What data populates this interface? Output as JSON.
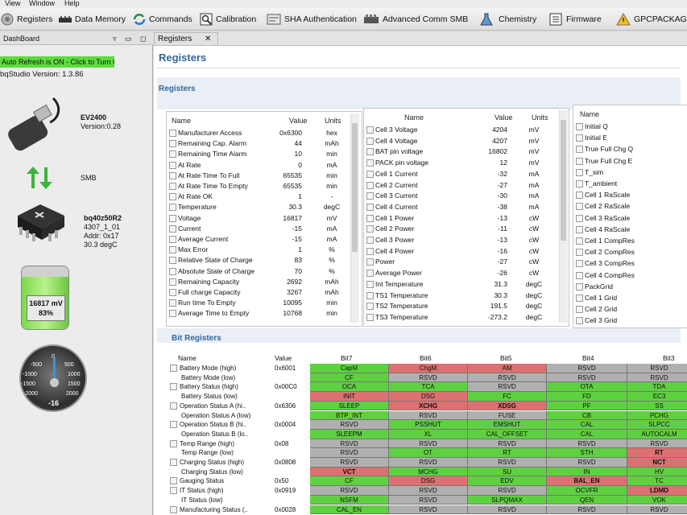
{
  "menu": [
    "View",
    "Window",
    "Help"
  ],
  "toolbar": [
    "Registers",
    "Data Memory",
    "Commands",
    "Calibration",
    "SHA Authentication",
    "Advanced Comm SMB",
    "Chemistry",
    "Firmware",
    "GPCPACKAGE"
  ],
  "dashboard": {
    "tab": "DashBoard",
    "auto_refresh": "Auto Refresh is ON - Click to Turn OFF",
    "version": "bqStudio Version:  1.3.86",
    "ev_name": "EV2400",
    "ev_version": "Version:0.28",
    "bus": "SMB",
    "device": "bq40z50R2",
    "device_fw": "4307_1_01",
    "device_addr": "Addr: 0x17",
    "device_temp": "30.3 degC",
    "battery_voltage": "16817 mV",
    "battery_soc": "83%",
    "battery_level": 0.83,
    "gauge_ticks": [
      "-500",
      "0",
      "500",
      "-1000",
      "1000",
      "-1500",
      "1500",
      "-2000",
      "2000"
    ],
    "gauge_value": "-16"
  },
  "main": {
    "tab": "Registers",
    "title": "Registers",
    "section": "Registers",
    "bit_section": "Bit Registers"
  },
  "panel1": {
    "headers": [
      "Name",
      "Value",
      "Units"
    ],
    "rows": [
      [
        "Manufacturer Access",
        "0x6300",
        "hex"
      ],
      [
        "Remaining Cap. Alarm",
        "44",
        "mAh"
      ],
      [
        "Remaining Time Alarm",
        "10",
        "min"
      ],
      [
        "At Rate",
        "0",
        "mA"
      ],
      [
        "At Rate Time To Full",
        "65535",
        "min"
      ],
      [
        "At Rate Time To Empty",
        "65535",
        "min"
      ],
      [
        "At Rate OK",
        "1",
        "-"
      ],
      [
        "Temperature",
        "30.3",
        "degC"
      ],
      [
        "Voltage",
        "16817",
        "mV"
      ],
      [
        "Current",
        "-15",
        "mA"
      ],
      [
        "Average Current",
        "-15",
        "mA"
      ],
      [
        "Max Error",
        "1",
        "%"
      ],
      [
        "Relative State of Charge",
        "83",
        "%"
      ],
      [
        "Absolute State of Charge",
        "70",
        "%"
      ],
      [
        "Remaining Capacity",
        "2692",
        "mAh"
      ],
      [
        "Full charge Capacity",
        "3267",
        "mAh"
      ],
      [
        "Run time To Empty",
        "10095",
        "min"
      ],
      [
        "Average Time to Empty",
        "10768",
        "min"
      ]
    ]
  },
  "panel2": {
    "headers": [
      "Name",
      "Value",
      "Units"
    ],
    "rows": [
      [
        "Cell 3 Voltage",
        "4204",
        "mV"
      ],
      [
        "Cell 4 Voltage",
        "4207",
        "mV"
      ],
      [
        "BAT pin voltage",
        "16802",
        "mV"
      ],
      [
        "PACK pin voltage",
        "12",
        "mV"
      ],
      [
        "Cell 1 Current",
        "-32",
        "mA"
      ],
      [
        "Cell 2 Current",
        "-27",
        "mA"
      ],
      [
        "Cell 3 Current",
        "-30",
        "mA"
      ],
      [
        "Cell 4 Current",
        "-38",
        "mA"
      ],
      [
        "Cell 1 Power",
        "-13",
        "cW"
      ],
      [
        "Cell 2 Power",
        "-11",
        "cW"
      ],
      [
        "Cell 3 Power",
        "-13",
        "cW"
      ],
      [
        "Cell 4 Power",
        "-16",
        "cW"
      ],
      [
        "Power",
        "-27",
        "cW"
      ],
      [
        "Average Power",
        "-26",
        "cW"
      ],
      [
        "Int Temperature",
        "31.3",
        "degC"
      ],
      [
        "TS1 Temperature",
        "30.3",
        "degC"
      ],
      [
        "TS2 Temperature",
        "191.5",
        "degC"
      ],
      [
        "TS3 Temperature",
        "-273.2",
        "degC"
      ]
    ]
  },
  "panel3": {
    "headers": [
      "Name"
    ],
    "rows": [
      "Initial Q",
      "Initial E",
      "True Full Chg Q",
      "True Full Chg E",
      "T_sim",
      "T_ambient",
      "Cell 1 RaScale",
      "Cell 2 RaScale",
      "Cell 3 RaScale",
      "Cell 4 RaScale",
      "Cell 1 CompRes",
      "Cell 2 CompRes",
      "Cell 3 CompRes",
      "Cell 4 CompRes",
      "PackGrid",
      "Cell 1 Grid",
      "Cell 2 Grid",
      "Cell 3 Grid"
    ]
  },
  "bits": {
    "headers": [
      "Name",
      "Value",
      "Bit7",
      "Bit6",
      "Bit5",
      "Bit4",
      "Bit3"
    ],
    "rows": [
      {
        "name": "Battery Mode (high)",
        "value": "0x6001",
        "cb": true,
        "cells": [
          [
            "CapM",
            "g"
          ],
          [
            "ChgM",
            "r"
          ],
          [
            "AM",
            "r"
          ],
          [
            "RSVD",
            "y"
          ],
          [
            "RSVD",
            "y"
          ]
        ]
      },
      {
        "name": "Battery Mode (low)",
        "value": "",
        "cb": false,
        "cells": [
          [
            "CF",
            "g"
          ],
          [
            "RSVD",
            "y"
          ],
          [
            "RSVD",
            "y"
          ],
          [
            "RSVD",
            "y"
          ],
          [
            "RSVD",
            "y"
          ]
        ]
      },
      {
        "name": "Battery Status (high)",
        "value": "0x00C0",
        "cb": true,
        "cells": [
          [
            "OCA",
            "g"
          ],
          [
            "TCA",
            "g"
          ],
          [
            "RSVD",
            "y"
          ],
          [
            "OTA",
            "g"
          ],
          [
            "TDA",
            "g"
          ]
        ]
      },
      {
        "name": "Battery Status (low)",
        "value": "",
        "cb": false,
        "cells": [
          [
            "INIT",
            "r"
          ],
          [
            "DSG",
            "r"
          ],
          [
            "FC",
            "g"
          ],
          [
            "FD",
            "g"
          ],
          [
            "EC3",
            "g"
          ]
        ]
      },
      {
        "name": "Operation Status A (hi..",
        "value": "0x6306",
        "cb": true,
        "cells": [
          [
            "SLEEP",
            "g"
          ],
          [
            "XCHG",
            "r"
          ],
          [
            "XDSG",
            "r"
          ],
          [
            "PF",
            "g"
          ],
          [
            "SS",
            "g"
          ]
        ]
      },
      {
        "name": "Operation Status A (low)",
        "value": "",
        "cb": false,
        "cells": [
          [
            "BTP_INT",
            "g"
          ],
          [
            "RSVD",
            "y"
          ],
          [
            "FUSE",
            "y"
          ],
          [
            "CB",
            "g"
          ],
          [
            "PCHG",
            "g"
          ]
        ]
      },
      {
        "name": "Operation Status B (hi..",
        "value": "0x0004",
        "cb": true,
        "cells": [
          [
            "RSVD",
            "y"
          ],
          [
            "PSSHUT",
            "g"
          ],
          [
            "EMSHUT",
            "g"
          ],
          [
            "CAL",
            "g"
          ],
          [
            "SLPCC",
            "g"
          ]
        ]
      },
      {
        "name": "Operation Status B (lo..",
        "value": "",
        "cb": false,
        "cells": [
          [
            "SLEEPM",
            "g"
          ],
          [
            "XL",
            "g"
          ],
          [
            "CAL_OFFSET",
            "g"
          ],
          [
            "CAL",
            "g"
          ],
          [
            "AUTOCALM",
            "g"
          ]
        ]
      },
      {
        "name": "Temp Range (high)",
        "value": "0x08",
        "cb": true,
        "cells": [
          [
            "RSVD",
            "y"
          ],
          [
            "RSVD",
            "y"
          ],
          [
            "RSVD",
            "y"
          ],
          [
            "RSVD",
            "y"
          ],
          [
            "RSVD",
            "y"
          ]
        ]
      },
      {
        "name": "Temp Range (low)",
        "value": "",
        "cb": false,
        "cells": [
          [
            "RSVD",
            "y"
          ],
          [
            "OT",
            "g"
          ],
          [
            "RT",
            "g"
          ],
          [
            "STH",
            "g"
          ],
          [
            "RT",
            "r"
          ]
        ]
      },
      {
        "name": "Charging Status (high)",
        "value": "0x0808",
        "cb": true,
        "cells": [
          [
            "RSVD",
            "y"
          ],
          [
            "RSVD",
            "y"
          ],
          [
            "RSVD",
            "y"
          ],
          [
            "RSVD",
            "y"
          ],
          [
            "NCT",
            "r"
          ]
        ]
      },
      {
        "name": "Charging Status (low)",
        "value": "",
        "cb": false,
        "cells": [
          [
            "VCT",
            "r"
          ],
          [
            "MCHG",
            "g"
          ],
          [
            "SU",
            "g"
          ],
          [
            "IN",
            "g"
          ],
          [
            "HV",
            "g"
          ]
        ]
      },
      {
        "name": "Gauging Status",
        "value": "0x50",
        "cb": true,
        "cells": [
          [
            "CF",
            "g"
          ],
          [
            "DSG",
            "r"
          ],
          [
            "EDV",
            "g"
          ],
          [
            "BAL_EN",
            "r"
          ],
          [
            "TC",
            "g"
          ]
        ]
      },
      {
        "name": "IT Status (high)",
        "value": "0x0919",
        "cb": true,
        "cells": [
          [
            "RSVD",
            "y"
          ],
          [
            "RSVD",
            "y"
          ],
          [
            "RSVD",
            "y"
          ],
          [
            "OCVFR",
            "g"
          ],
          [
            "LDMD",
            "r"
          ]
        ]
      },
      {
        "name": "IT Status (low)",
        "value": "",
        "cb": false,
        "cells": [
          [
            "NSFM",
            "g"
          ],
          [
            "RSVD",
            "y"
          ],
          [
            "SLPQMAX",
            "g"
          ],
          [
            "QEN",
            "g"
          ],
          [
            "VOK",
            "g"
          ]
        ]
      },
      {
        "name": "Manufacturing Status (..",
        "value": "0x0028",
        "cb": true,
        "cells": [
          [
            "CAL_EN",
            "g"
          ],
          [
            "RSVD",
            "y"
          ],
          [
            "RSVD",
            "y"
          ],
          [
            "RSVD",
            "y"
          ],
          [
            "RSVD",
            "y"
          ]
        ]
      }
    ]
  }
}
